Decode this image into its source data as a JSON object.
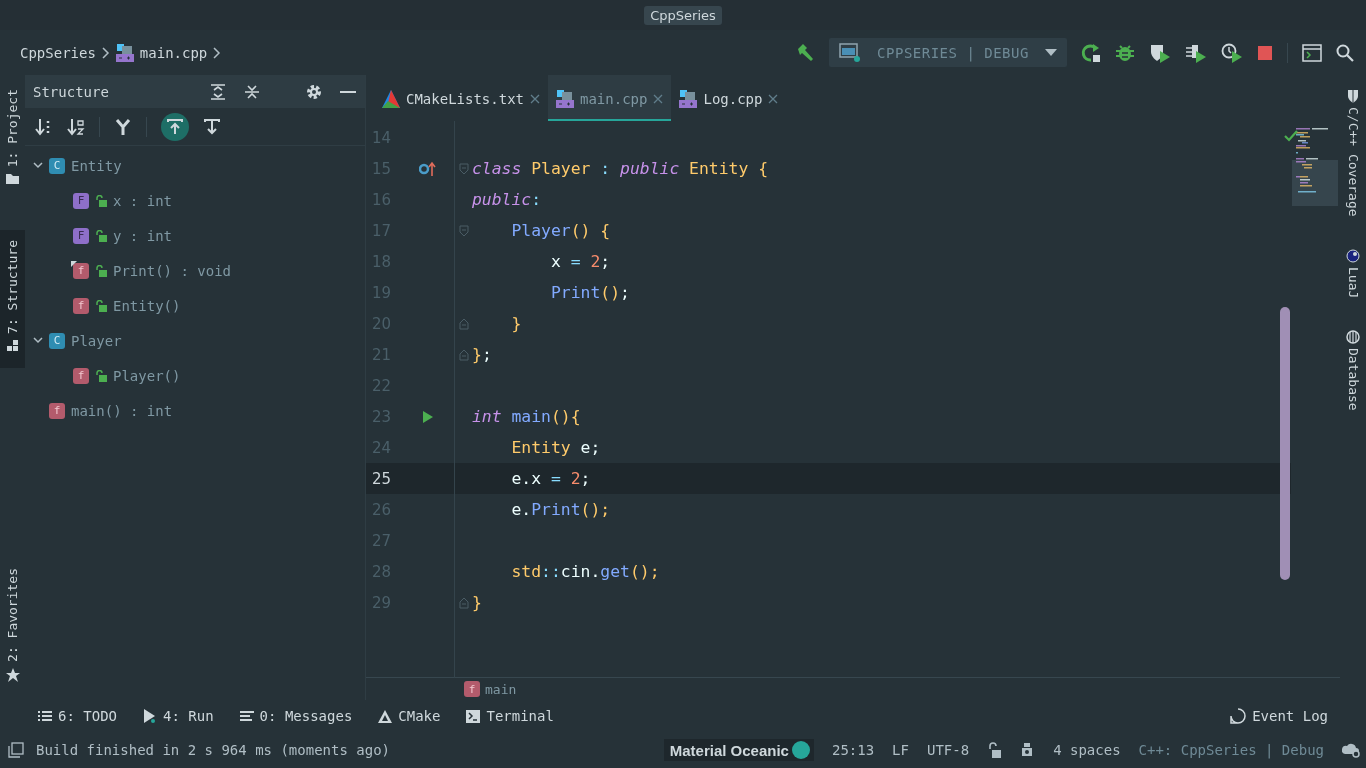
{
  "window": {
    "title": "CppSeries"
  },
  "breadcrumb": [
    {
      "label": "CppSeries",
      "kind": "folder"
    },
    {
      "label": "main.cpp",
      "kind": "cpp"
    }
  ],
  "run_config": {
    "label": "CPPSERIES | DEBUG"
  },
  "left_stripe": {
    "top": [
      {
        "label": "1: Project",
        "kind": "project",
        "selected": false
      },
      {
        "label": "7: Structure",
        "kind": "structure",
        "selected": true
      }
    ],
    "bottom": [
      {
        "label": "2: Favorites",
        "kind": "favorites",
        "selected": false
      }
    ]
  },
  "structure": {
    "title": "Structure",
    "tree": [
      {
        "badge": "C",
        "kind": "class",
        "label": "Entity",
        "expanded": true,
        "children": [
          {
            "badge": "F",
            "kind": "field",
            "label": "x : int",
            "public": true,
            "overridden": false
          },
          {
            "badge": "F",
            "kind": "field",
            "label": "y : int",
            "public": true,
            "overridden": false
          },
          {
            "badge": "f",
            "kind": "method",
            "label": "Print() : void",
            "public": true,
            "overridden": true
          },
          {
            "badge": "f",
            "kind": "method",
            "label": "Entity()",
            "public": true,
            "overridden": false
          }
        ]
      },
      {
        "badge": "C",
        "kind": "class",
        "label": "Player",
        "expanded": true,
        "children": [
          {
            "badge": "f",
            "kind": "method",
            "label": "Player()",
            "public": true,
            "overridden": false
          }
        ]
      },
      {
        "badge": "f",
        "kind": "method",
        "label": "main() : int",
        "public": false,
        "overridden": false
      }
    ]
  },
  "tabs": [
    {
      "label": "CMakeLists.txt",
      "kind": "cmake",
      "selected": false
    },
    {
      "label": "main.cpp",
      "kind": "cpp",
      "selected": true
    },
    {
      "label": "Log.cpp",
      "kind": "cpp",
      "selected": false
    }
  ],
  "editor": {
    "lines": [
      {
        "number": "14",
        "current": false
      },
      {
        "number": "15",
        "current": false,
        "gutter": {
          "kind": "override"
        },
        "fold": {
          "kind": "start"
        },
        "tokens": [
          {
            "text": "class",
            "kind": "kw"
          },
          {
            "text": " Player ",
            "kind": "type"
          },
          {
            "text": ":",
            "kind": "op"
          },
          {
            "text": " public",
            "kind": "kw"
          },
          {
            "text": " Entity {",
            "kind": "type"
          }
        ]
      },
      {
        "number": "16",
        "current": false,
        "tokens": [
          {
            "text": "public",
            "kind": "kwp"
          },
          {
            "text": ":",
            "kind": "op"
          }
        ]
      },
      {
        "number": "17",
        "current": false,
        "fold": {
          "kind": "start"
        },
        "tokens": [
          {
            "text": "    Player",
            "kind": "fn"
          },
          {
            "text": "() {",
            "kind": "type"
          }
        ]
      },
      {
        "number": "18",
        "current": false,
        "tokens": [
          {
            "text": "        x ",
            "kind": "var"
          },
          {
            "text": "=",
            "kind": "op"
          },
          {
            "text": " 2",
            "kind": "num"
          },
          {
            "text": ";",
            "kind": "var"
          }
        ]
      },
      {
        "number": "19",
        "current": false,
        "tokens": [
          {
            "text": "        Print",
            "kind": "fn"
          },
          {
            "text": "()",
            "kind": "type"
          },
          {
            "text": ";",
            "kind": "var"
          }
        ]
      },
      {
        "number": "20",
        "current": false,
        "fold": {
          "kind": "end"
        },
        "tokens": [
          {
            "text": "    }",
            "kind": "type"
          }
        ]
      },
      {
        "number": "21",
        "current": false,
        "fold": {
          "kind": "end"
        },
        "tokens": [
          {
            "text": "}",
            "kind": "type"
          },
          {
            "text": ";",
            "kind": "var"
          }
        ]
      },
      {
        "number": "22",
        "current": false
      },
      {
        "number": "23",
        "current": false,
        "gutter": {
          "kind": "run"
        },
        "tokens": [
          {
            "text": "int",
            "kind": "kw"
          },
          {
            "text": " main",
            "kind": "fn"
          },
          {
            "text": "(){",
            "kind": "type"
          }
        ]
      },
      {
        "number": "24",
        "current": false,
        "tokens": [
          {
            "text": "    Entity",
            "kind": "type"
          },
          {
            "text": " e;",
            "kind": "var"
          }
        ]
      },
      {
        "number": "25",
        "current": true,
        "tokens": [
          {
            "text": "    e.x ",
            "kind": "var"
          },
          {
            "text": "=",
            "kind": "op"
          },
          {
            "text": " 2",
            "kind": "num"
          },
          {
            "text": ";",
            "kind": "var"
          }
        ]
      },
      {
        "number": "26",
        "current": false,
        "tokens": [
          {
            "text": "    e.",
            "kind": "var"
          },
          {
            "text": "Print",
            "kind": "fn"
          },
          {
            "text": "();",
            "kind": "type"
          }
        ]
      },
      {
        "number": "27",
        "current": false
      },
      {
        "number": "28",
        "current": false,
        "tokens": [
          {
            "text": "    std",
            "kind": "type"
          },
          {
            "text": "::",
            "kind": "op"
          },
          {
            "text": "cin.",
            "kind": "var"
          },
          {
            "text": "get",
            "kind": "fn"
          },
          {
            "text": "();",
            "kind": "type"
          }
        ]
      },
      {
        "number": "29",
        "current": false,
        "fold": {
          "kind": "end"
        },
        "tokens": [
          {
            "text": "}",
            "kind": "type"
          }
        ]
      }
    ],
    "breadcrumb": {
      "badge": "f",
      "label": "main"
    }
  },
  "right_stripe": [
    {
      "label": "C/C++ Coverage",
      "kind": "coverage"
    },
    {
      "label": "LuaJ",
      "kind": "luaj"
    },
    {
      "label": "Database",
      "kind": "database"
    }
  ],
  "bottom_tabs": [
    {
      "label": "6: TODO",
      "kind": "todo"
    },
    {
      "label": "4: Run",
      "kind": "run"
    },
    {
      "label": "0: Messages",
      "kind": "messages"
    },
    {
      "label": "CMake",
      "kind": "cmake"
    },
    {
      "label": "Terminal",
      "kind": "terminal"
    }
  ],
  "event_log": {
    "label": "Event Log"
  },
  "status_bar": {
    "message": "Build finished in 2 s 964 ms (moments ago)",
    "theme": "Material Oceanic",
    "position": "25:13",
    "line_ending": "LF",
    "encoding": "UTF-8",
    "indent": "4 spaces",
    "context": "C++: CppSeries | Debug"
  }
}
